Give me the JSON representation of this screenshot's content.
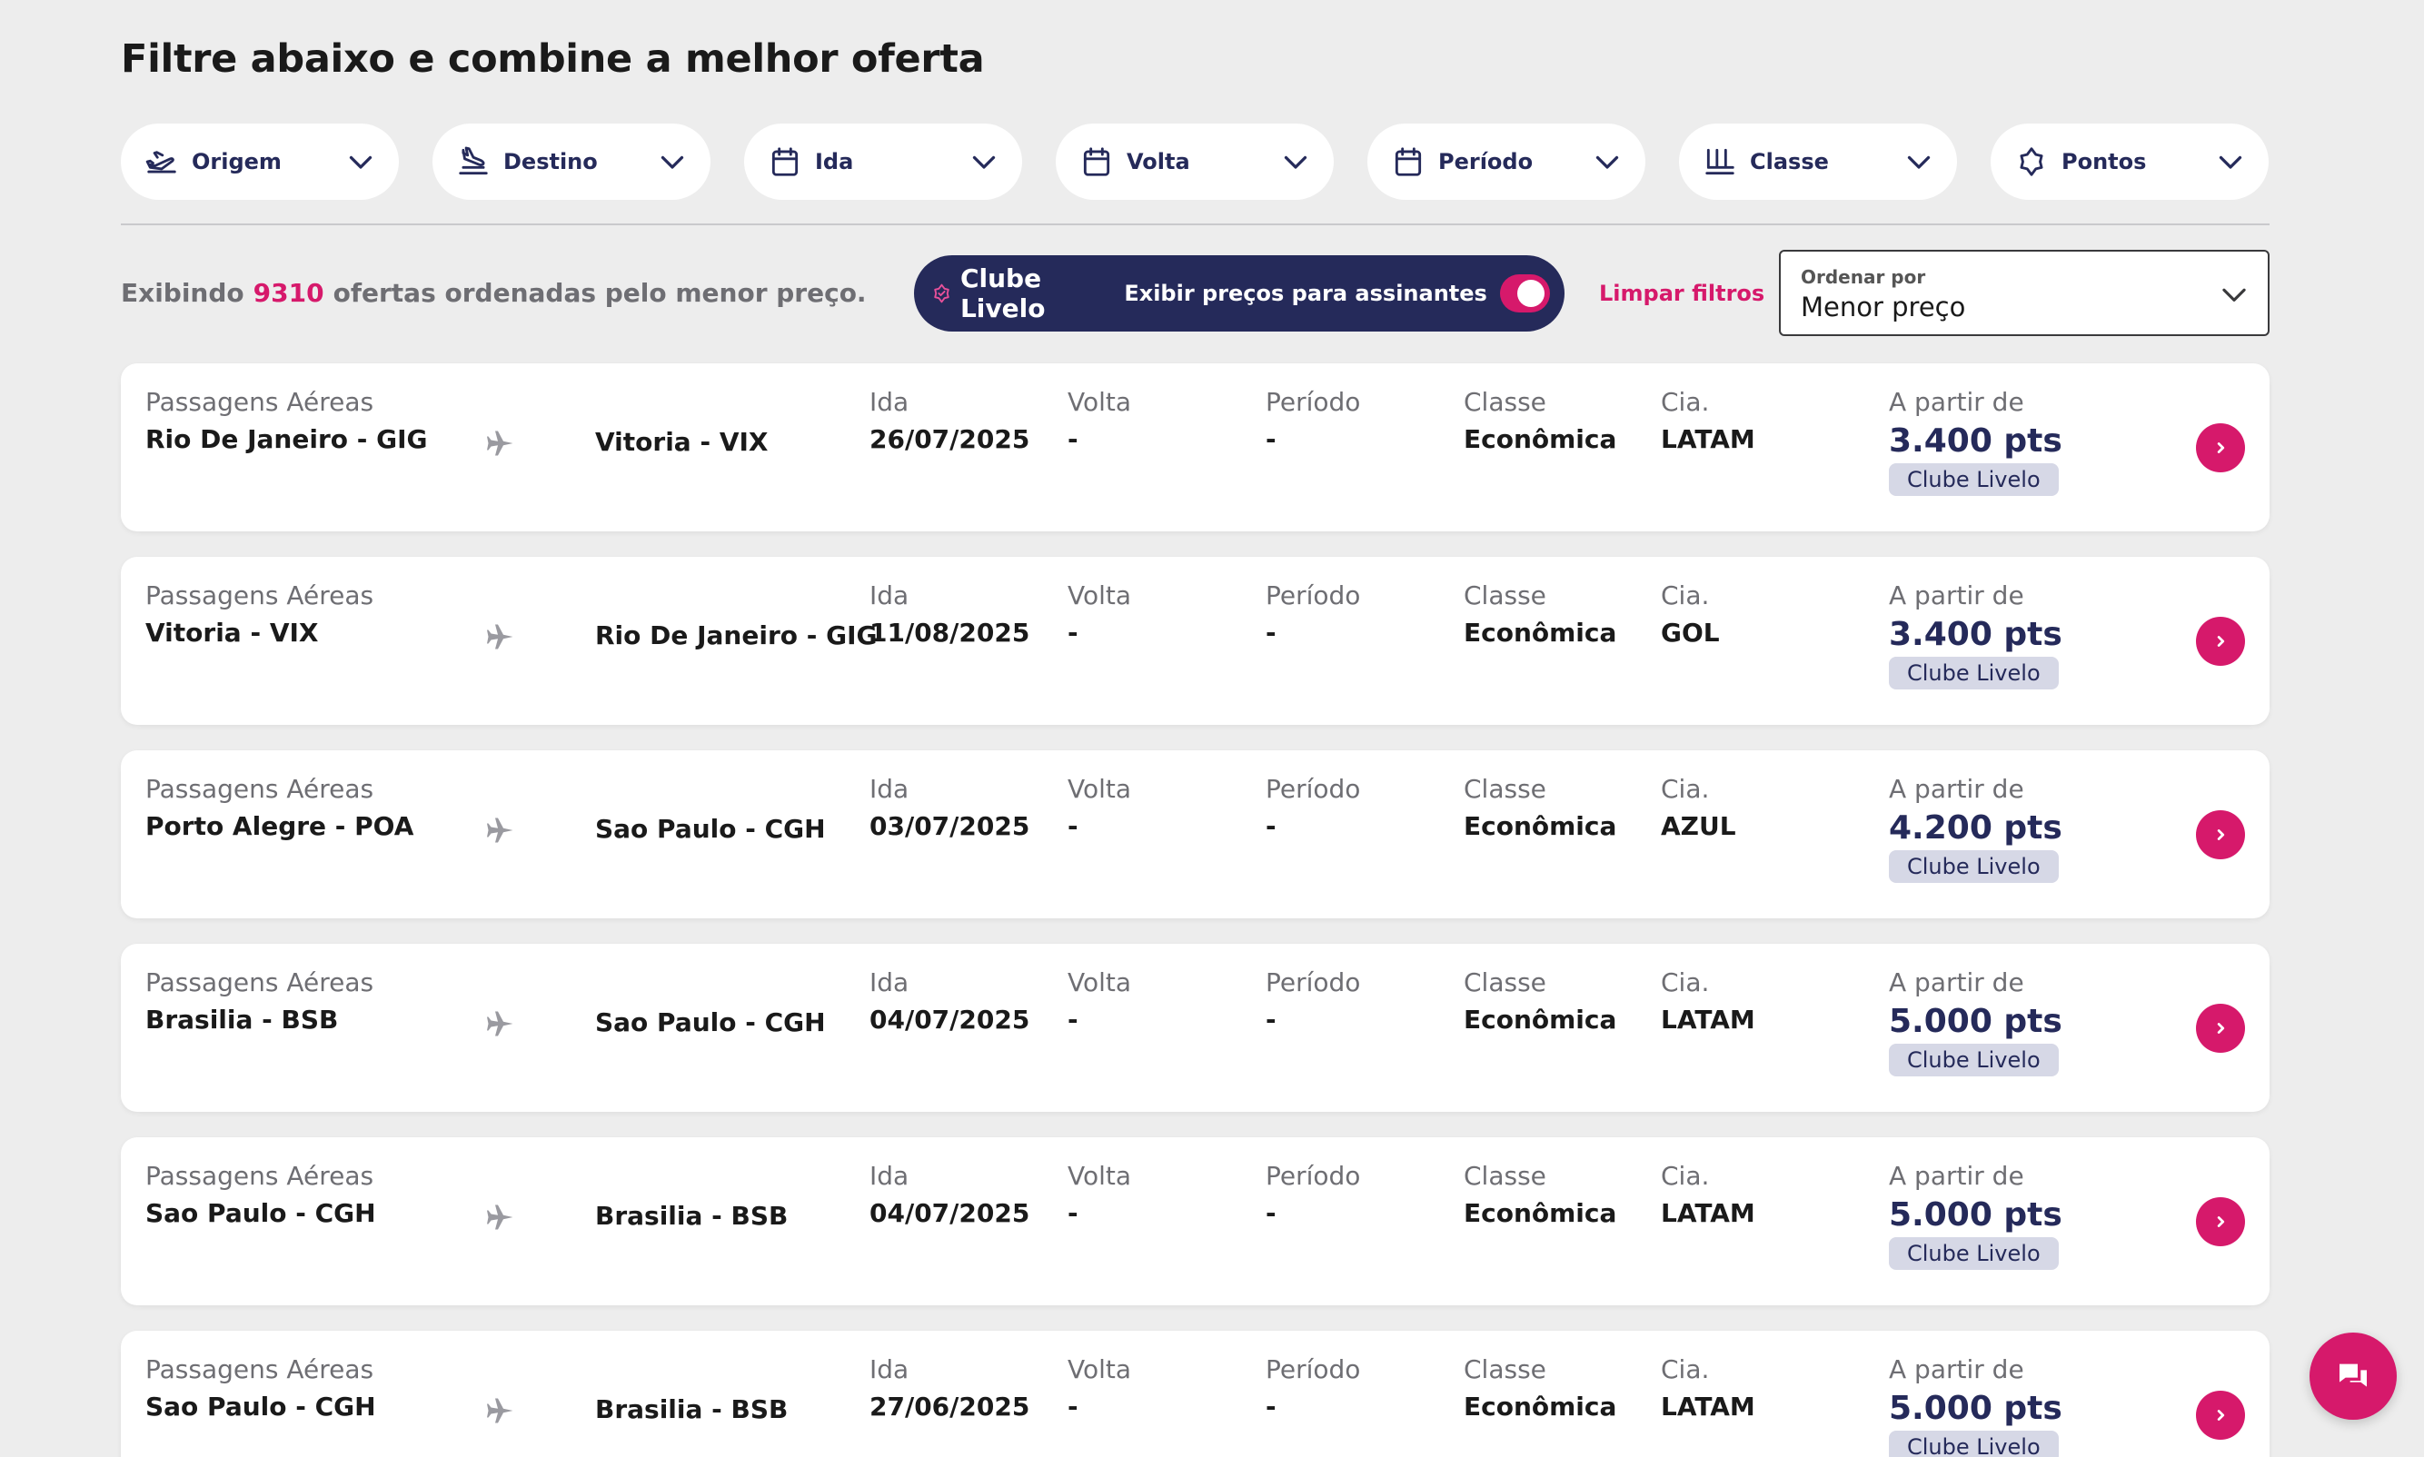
{
  "headline": "Filtre abaixo e combine a melhor oferta",
  "filters": [
    {
      "label": "Origem",
      "icon": "plane-takeoff-icon"
    },
    {
      "label": "Destino",
      "icon": "plane-landing-icon"
    },
    {
      "label": "Ida",
      "icon": "calendar-icon"
    },
    {
      "label": "Volta",
      "icon": "calendar-icon"
    },
    {
      "label": "Período",
      "icon": "calendar-icon"
    },
    {
      "label": "Classe",
      "icon": "seat-icon"
    },
    {
      "label": "Pontos",
      "icon": "points-icon"
    }
  ],
  "summary": {
    "prefix": "Exibindo",
    "count": "9310",
    "suffix": "ofertas ordenadas pelo menor preço."
  },
  "clube": {
    "brand": "Clube Livelo",
    "toggle_label": "Exibir preços para assinantes",
    "toggle_on": true
  },
  "clear_filters": "Limpar filtros",
  "sort": {
    "label": "Ordenar por",
    "value": "Menor preço"
  },
  "labels": {
    "category": "Passagens Aéreas",
    "ida": "Ida",
    "volta": "Volta",
    "periodo": "Período",
    "classe": "Classe",
    "cia": "Cia.",
    "from": "A partir de"
  },
  "offers": [
    {
      "origin": "Rio De Janeiro - GIG",
      "destination": "Vitoria - VIX",
      "ida": "26/07/2025",
      "volta": "-",
      "periodo": "-",
      "classe": "Econômica",
      "cia": "LATAM",
      "price": "3.400 pts",
      "badge": "Clube Livelo"
    },
    {
      "origin": "Vitoria - VIX",
      "destination": "Rio De Janeiro - GIG",
      "ida": "11/08/2025",
      "volta": "-",
      "periodo": "-",
      "classe": "Econômica",
      "cia": "GOL",
      "price": "3.400 pts",
      "badge": "Clube Livelo"
    },
    {
      "origin": "Porto Alegre - POA",
      "destination": "Sao Paulo - CGH",
      "ida": "03/07/2025",
      "volta": "-",
      "periodo": "-",
      "classe": "Econômica",
      "cia": "AZUL",
      "price": "4.200 pts",
      "badge": "Clube Livelo"
    },
    {
      "origin": "Brasilia - BSB",
      "destination": "Sao Paulo - CGH",
      "ida": "04/07/2025",
      "volta": "-",
      "periodo": "-",
      "classe": "Econômica",
      "cia": "LATAM",
      "price": "5.000 pts",
      "badge": "Clube Livelo"
    },
    {
      "origin": "Sao Paulo - CGH",
      "destination": "Brasilia - BSB",
      "ida": "04/07/2025",
      "volta": "-",
      "periodo": "-",
      "classe": "Econômica",
      "cia": "LATAM",
      "price": "5.000 pts",
      "badge": "Clube Livelo"
    },
    {
      "origin": "Sao Paulo - CGH",
      "destination": "Brasilia - BSB",
      "ida": "27/06/2025",
      "volta": "-",
      "periodo": "-",
      "classe": "Econômica",
      "cia": "LATAM",
      "price": "5.000 pts",
      "badge": "Clube Livelo"
    }
  ],
  "colors": {
    "brand_navy": "#252a5a",
    "brand_pink": "#d6196b",
    "background": "#ededed"
  }
}
